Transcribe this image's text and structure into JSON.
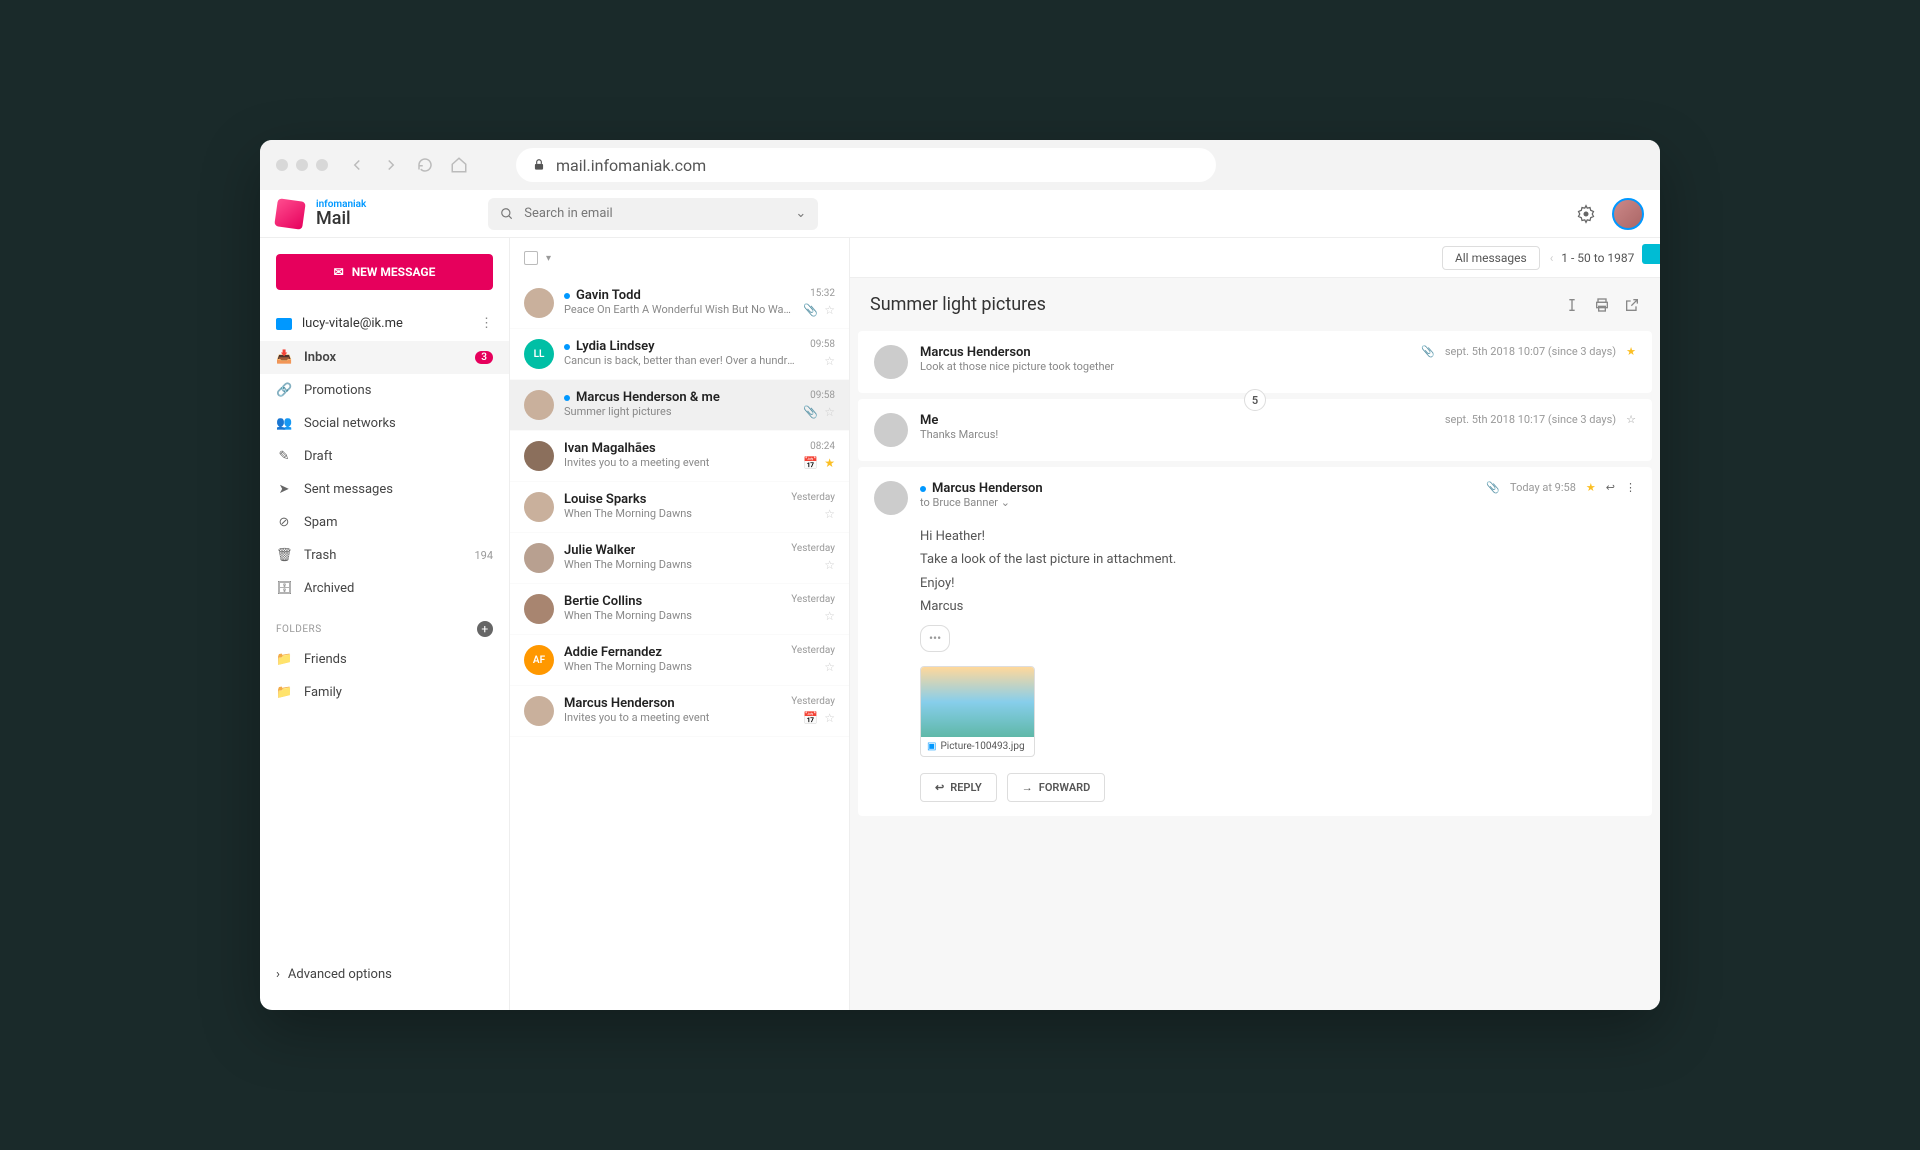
{
  "browser": {
    "url": "mail.infomaniak.com"
  },
  "brand": {
    "top": "infomaniak",
    "name": "Mail"
  },
  "search": {
    "placeholder": "Search in email"
  },
  "newMessage": "NEW MESSAGE",
  "account": {
    "email": "lucy-vitale@ik.me"
  },
  "nav": [
    {
      "icon": "📥",
      "label": "Inbox",
      "badge": "3",
      "active": true
    },
    {
      "icon": "🔗",
      "label": "Promotions"
    },
    {
      "icon": "👥",
      "label": "Social networks"
    },
    {
      "icon": "✎",
      "label": "Draft"
    },
    {
      "icon": "➤",
      "label": "Sent messages"
    },
    {
      "icon": "⊘",
      "label": "Spam"
    },
    {
      "icon": "🗑",
      "label": "Trash",
      "count": "194"
    },
    {
      "icon": "🗄",
      "label": "Archived"
    }
  ],
  "foldersHeader": "FOLDERS",
  "folders": [
    {
      "label": "Friends"
    },
    {
      "label": "Family"
    }
  ],
  "advanced": "Advanced options",
  "toolbar": {
    "allMessages": "All messages",
    "pager": "1 - 50 to 1987"
  },
  "messages": [
    {
      "unread": true,
      "sender": "Gavin Todd",
      "preview": "Peace On Earth A Wonderful Wish But No Way…",
      "time": "15:32",
      "attach": true,
      "avColor": "#c9b09c"
    },
    {
      "unread": true,
      "sender": "Lydia Lindsey",
      "preview": "Cancun is back, better than ever! Over a hundred…",
      "time": "09:58",
      "avColor": "#00bfa5",
      "initials": "LL"
    },
    {
      "unread": true,
      "sender": "Marcus Henderson & me",
      "preview": "Summer light pictures",
      "time": "09:58",
      "attach": true,
      "selected": true,
      "avColor": "#c9b09c"
    },
    {
      "sender": "Ivan Magalhães",
      "preview": "Invites you to a meeting event",
      "time": "08:24",
      "calendar": true,
      "star": true,
      "avColor": "#8b6f5c"
    },
    {
      "sender": "Louise Sparks",
      "preview": "When The Morning Dawns",
      "time": "Yesterday",
      "avColor": "#c9b09c"
    },
    {
      "sender": "Julie Walker",
      "preview": "When The Morning Dawns",
      "time": "Yesterday",
      "avColor": "#b8a090"
    },
    {
      "sender": "Bertie Collins",
      "preview": "When The Morning Dawns",
      "time": "Yesterday",
      "avColor": "#a88570"
    },
    {
      "sender": "Addie Fernandez",
      "preview": "When The Morning Dawns",
      "time": "Yesterday",
      "avColor": "#ff9800",
      "initials": "AF"
    },
    {
      "sender": "Marcus Henderson",
      "preview": "Invites you to a meeting event",
      "time": "Yesterday",
      "calendar": true,
      "avColor": "#c9b09c"
    }
  ],
  "subject": "Summer light pictures",
  "thread": {
    "collapsed": [
      {
        "from": "Marcus Henderson",
        "sub": "Look at those nice picture took together",
        "date": "sept. 5th 2018 10:07 (since 3 days)",
        "attach": true,
        "star": true
      },
      {
        "from": "Me",
        "sub": "Thanks Marcus!",
        "date": "sept. 5th 2018 10:17 (since 3 days)"
      }
    ],
    "count": "5",
    "open": {
      "from": "Marcus Henderson",
      "to": "to Bruce Banner",
      "date": "Today at 9:58",
      "body": [
        "Hi Heather!",
        "Take a look of the last picture in attachment.",
        "Enjoy!",
        "Marcus"
      ],
      "attachment": "Picture-100493.jpg"
    }
  },
  "actions": {
    "reply": "REPLY",
    "forward": "FORWARD"
  }
}
